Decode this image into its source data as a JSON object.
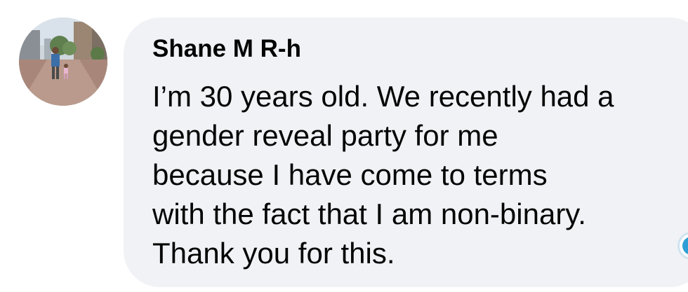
{
  "comment": {
    "author": "Shane M R-h",
    "lines": [
      "I’m 30 years old. We recently had a",
      "gender reveal party for me",
      "because I have come to terms",
      "with the fact that I am non-binary.",
      "Thank you for this."
    ]
  },
  "colors": {
    "bubble": "#f0f2f5",
    "text": "#050505",
    "reaction": "#2d9fd6"
  }
}
